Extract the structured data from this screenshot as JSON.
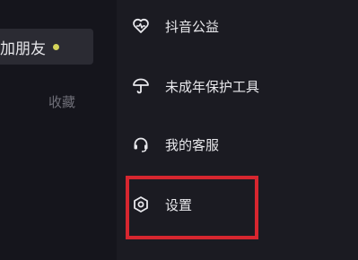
{
  "left_panel": {
    "add_friend_label": "加朋友",
    "favorites_label": "收藏"
  },
  "menu": {
    "items": [
      {
        "label": "抖音公益",
        "icon": "heart-pulse-icon"
      },
      {
        "label": "未成年保护工具",
        "icon": "umbrella-icon"
      },
      {
        "label": "我的客服",
        "icon": "headset-icon"
      },
      {
        "label": "设置",
        "icon": "settings-hexagon-icon"
      }
    ]
  },
  "colors": {
    "highlight_border": "#d7262f",
    "online_dot": "#d4d45a"
  }
}
